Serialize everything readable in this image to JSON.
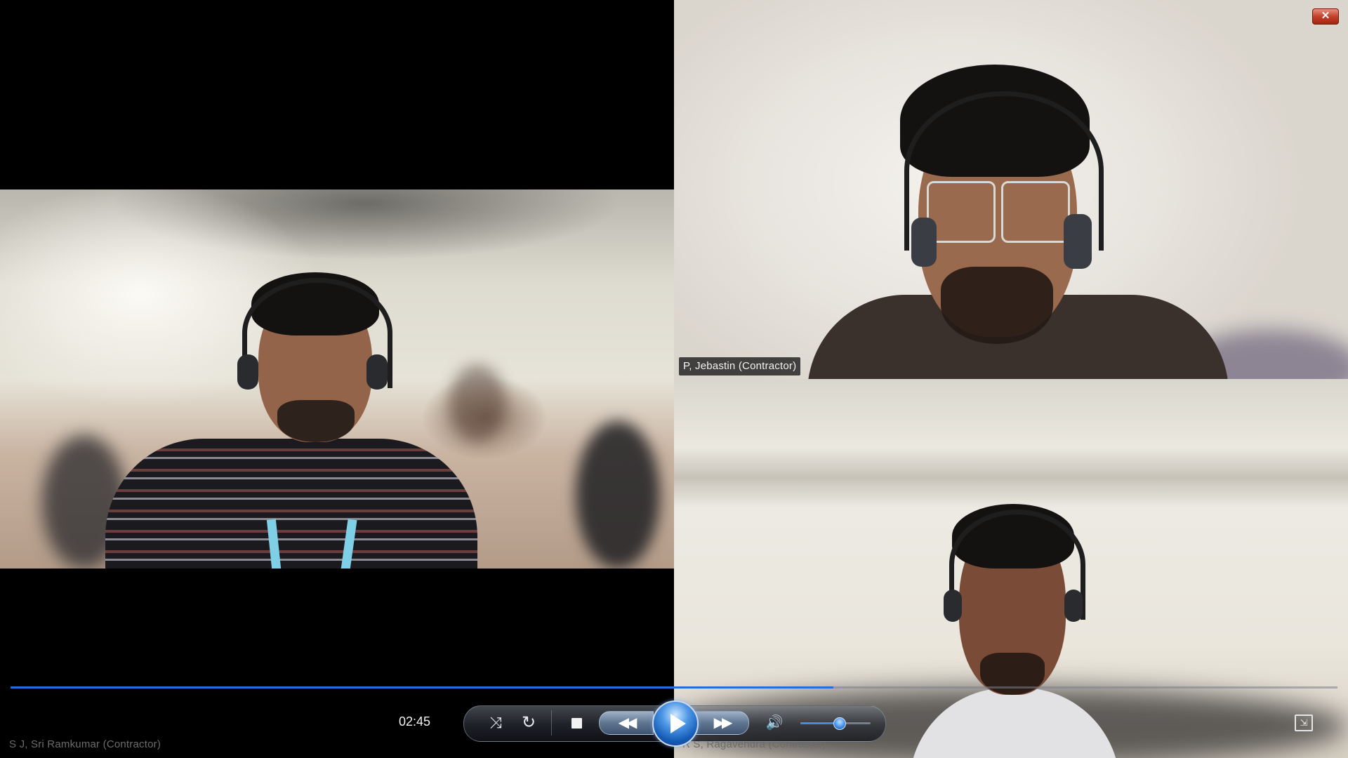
{
  "window": {
    "close_symbol": "✕",
    "close_icon": "close-icon"
  },
  "participants": [
    {
      "name": "S J, Sri Ramkumar (Contractor)",
      "position": "left"
    },
    {
      "name": "P, Jebastin (Contractor)",
      "position": "top-right"
    },
    {
      "name": "R S, Ragavendra (Contractor)",
      "position": "bottom-right"
    }
  ],
  "player": {
    "time": "02:45",
    "progress": 0.62,
    "volume": 0.55,
    "icons": {
      "shuffle": "shuffle-icon",
      "repeat": "repeat-icon",
      "stop": "stop-icon",
      "previous": "rewind-icon",
      "play": "play-icon",
      "next": "fast-forward-icon",
      "volume": "speaker-icon",
      "switch_view": "switch-to-library-icon"
    },
    "glyphs": {
      "shuffle": "⤨",
      "repeat": "↻",
      "previous": "◀◀",
      "next": "▶▶",
      "volume": "🔊",
      "switch_view": "⇲"
    },
    "colors": {
      "accent": "#1f6fe0",
      "play_button": "#145bb5",
      "close_button": "#c3412a"
    }
  }
}
